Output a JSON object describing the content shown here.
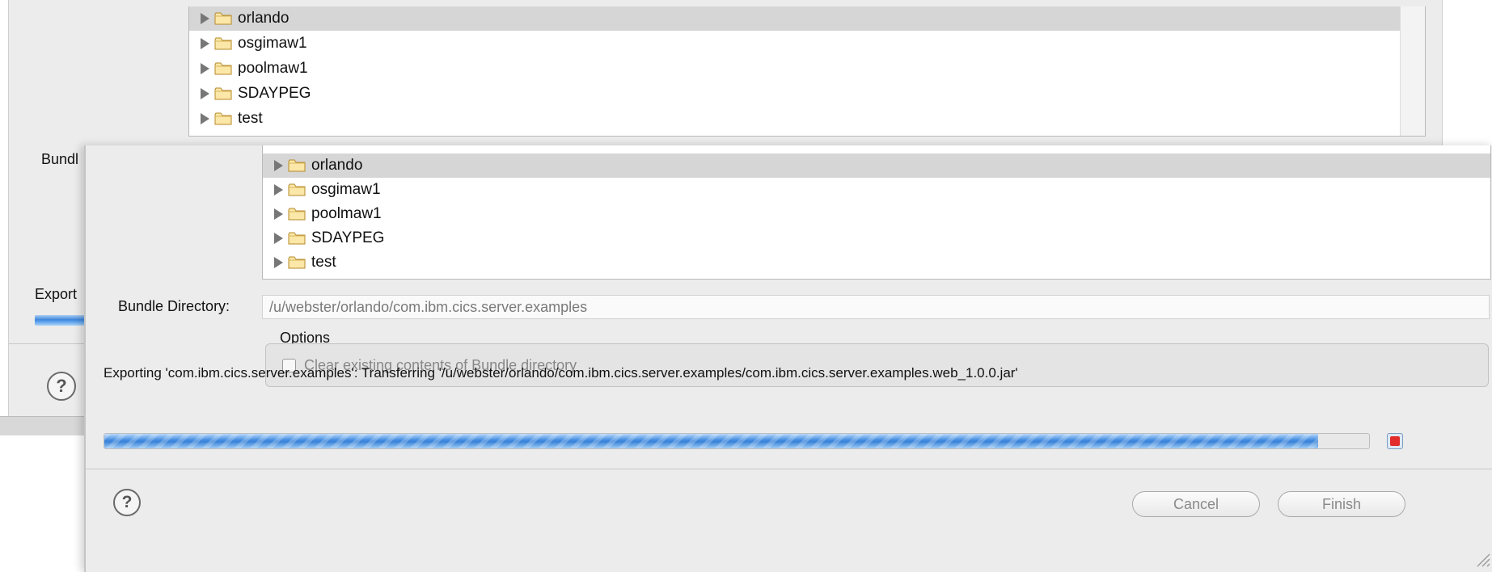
{
  "back_dialog": {
    "tree_items": [
      {
        "label": "orlando",
        "selected": true
      },
      {
        "label": "osgimaw1",
        "selected": false
      },
      {
        "label": "poolmaw1",
        "selected": false
      },
      {
        "label": "SDAYPEG",
        "selected": false
      },
      {
        "label": "test",
        "selected": false
      }
    ],
    "bundle_label": "Bundl",
    "export_label": "Export",
    "help_glyph": "?"
  },
  "front_dialog": {
    "tree_items": [
      {
        "label": "orlando",
        "selected": true
      },
      {
        "label": "osgimaw1",
        "selected": false
      },
      {
        "label": "poolmaw1",
        "selected": false
      },
      {
        "label": "SDAYPEG",
        "selected": false
      },
      {
        "label": "test",
        "selected": false
      }
    ],
    "bundle_directory_label": "Bundle Directory:",
    "bundle_directory_value": "/u/webster/orlando/com.ibm.cics.server.examples",
    "options_label": "Options",
    "clear_checkbox_label": "Clear existing contents of Bundle directory",
    "status_text": "Exporting 'com.ibm.cics.server.examples': Transferring '/u/webster/orlando/com.ibm.cics.server.examples/com.ibm.cics.server.examples.web_1.0.0.jar'",
    "progress_percent": 96,
    "help_glyph": "?",
    "cancel_label": "Cancel",
    "finish_label": "Finish"
  },
  "colors": {
    "dialog_bg": "#ececec",
    "selection": "#d6d6d6",
    "progress_blue": "#3e89df",
    "stop_red": "#e22c2c"
  },
  "icons": [
    "disclosure-triangle-icon",
    "folder-icon",
    "help-icon",
    "stop-icon",
    "resize-grip-icon"
  ]
}
